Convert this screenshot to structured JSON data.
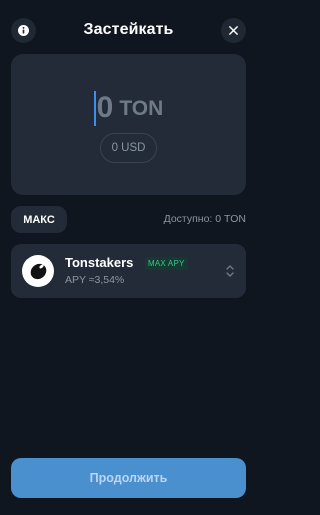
{
  "header": {
    "title": "Застейкать",
    "info_icon": "info-icon",
    "close_icon": "close-icon"
  },
  "amount": {
    "value": "0",
    "unit": "TON",
    "fiat": "0 USD"
  },
  "controls": {
    "max_label": "МАКС",
    "available": "Доступно: 0 TON"
  },
  "provider": {
    "name": "Tonstakers",
    "badge": "MAX APY",
    "apy": "APY ≈3,54%",
    "logo_icon": "tonstakers-logo",
    "selector_icon": "chevron-up-down-icon"
  },
  "footer": {
    "continue_label": "Продолжить"
  },
  "colors": {
    "background": "#10161f",
    "card": "#222b37",
    "accent": "#4a8fce",
    "caret": "#3f8df0",
    "badge_text": "#35c48a",
    "muted_text": "#8b96a3"
  }
}
